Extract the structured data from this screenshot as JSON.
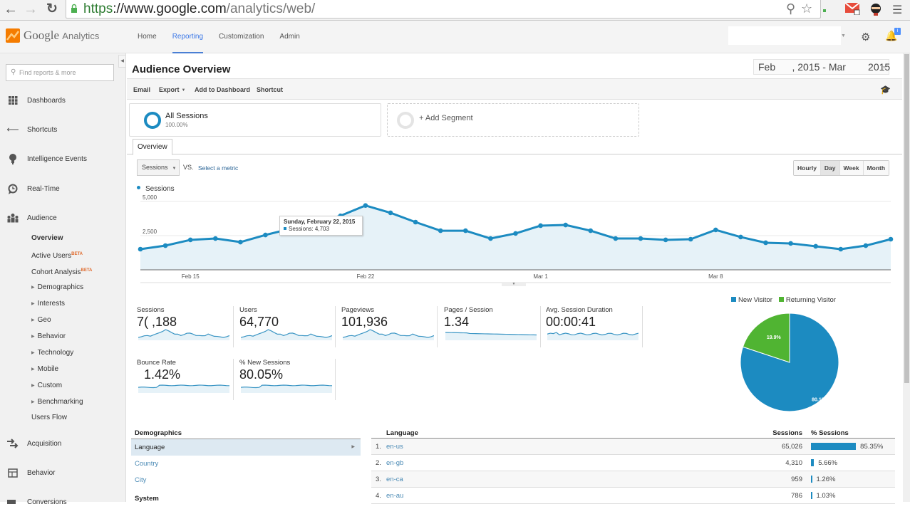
{
  "browser": {
    "url_scheme": "https",
    "url_host": "://www.google.com",
    "url_path": "/analytics/web/"
  },
  "header": {
    "logo_google": "Google",
    "logo_analytics": "Analytics",
    "nav": [
      {
        "label": "Home",
        "active": false
      },
      {
        "label": "Reporting",
        "active": true
      },
      {
        "label": "Customization",
        "active": false
      },
      {
        "label": "Admin",
        "active": false
      }
    ],
    "notification_badge": "i"
  },
  "sidebar": {
    "search_placeholder": "Find reports & more",
    "sections": [
      {
        "label": "Dashboards",
        "icon": "grid-icon"
      },
      {
        "label": "Shortcuts",
        "icon": "shortcut-arrow-icon"
      },
      {
        "label": "Intelligence Events",
        "icon": "lightbulb-icon"
      },
      {
        "label": "Real-Time",
        "icon": "clock-icon"
      },
      {
        "label": "Audience",
        "icon": "people-icon"
      }
    ],
    "audience_items": [
      {
        "label": "Overview",
        "active": true,
        "expandable": false,
        "badge": ""
      },
      {
        "label": "Active Users",
        "active": false,
        "expandable": false,
        "badge": "BETA"
      },
      {
        "label": "Cohort Analysis",
        "active": false,
        "expandable": false,
        "badge": "BETA"
      },
      {
        "label": "Demographics",
        "active": false,
        "expandable": true,
        "badge": ""
      },
      {
        "label": "Interests",
        "active": false,
        "expandable": true,
        "badge": ""
      },
      {
        "label": "Geo",
        "active": false,
        "expandable": true,
        "badge": ""
      },
      {
        "label": "Behavior",
        "active": false,
        "expandable": true,
        "badge": ""
      },
      {
        "label": "Technology",
        "active": false,
        "expandable": true,
        "badge": ""
      },
      {
        "label": "Mobile",
        "active": false,
        "expandable": true,
        "badge": ""
      },
      {
        "label": "Custom",
        "active": false,
        "expandable": true,
        "badge": ""
      },
      {
        "label": "Benchmarking",
        "active": false,
        "expandable": true,
        "badge": ""
      },
      {
        "label": "Users Flow",
        "active": false,
        "expandable": false,
        "badge": ""
      }
    ],
    "bottom_sections": [
      {
        "label": "Acquisition",
        "icon": "acquisition-icon"
      },
      {
        "label": "Behavior",
        "icon": "behavior-icon"
      },
      {
        "label": "Conversions",
        "icon": "conversions-icon"
      }
    ]
  },
  "main": {
    "title": "Audience Overview",
    "date_range": "Feb      , 2015 - Mar        2015",
    "toolbar": {
      "email": "Email",
      "export": "Export",
      "add_to_dashboard": "Add to Dashboard",
      "shortcut": "Shortcut"
    },
    "segments": {
      "all_title": "All Sessions",
      "all_pct": "100.00%",
      "add_label": "+ Add Segment"
    },
    "tab": "Overview",
    "metric_select": "Sessions",
    "vs": "VS.",
    "select_metric": "Select a metric",
    "granularity": [
      {
        "label": "Hourly",
        "active": false
      },
      {
        "label": "Day",
        "active": true
      },
      {
        "label": "Week",
        "active": false
      },
      {
        "label": "Month",
        "active": false
      }
    ],
    "tooltip": {
      "date": "Sunday, February 22, 2015",
      "value": "Sessions: 4,703"
    },
    "scorecards": [
      {
        "name": "Sessions",
        "value": "7( ,188"
      },
      {
        "name": "Users",
        "value": "64,770"
      },
      {
        "name": "Pageviews",
        "value": "101,936"
      },
      {
        "name": "Pages / Session",
        "value": "1.34"
      },
      {
        "name": "Avg. Session Duration",
        "value": "00:00:41"
      },
      {
        "name": "Bounce Rate",
        "value": "  1.42%"
      },
      {
        "name": "% New Sessions",
        "value": "80.05%"
      }
    ],
    "demographics": {
      "title": "Demographics",
      "items": [
        {
          "label": "Language",
          "active": true
        },
        {
          "label": "Country",
          "active": false
        },
        {
          "label": "City",
          "active": false
        }
      ],
      "system_title": "System"
    },
    "language_table": {
      "headers": {
        "language": "Language",
        "sessions": "Sessions",
        "pct": "% Sessions"
      },
      "rows": [
        {
          "rank": "1.",
          "language": "en-us",
          "sessions": "65,026",
          "pct": "85.35%",
          "pct_value": 85.35
        },
        {
          "rank": "2.",
          "language": "en-gb",
          "sessions": "4,310",
          "pct": "5.66%",
          "pct_value": 5.66
        },
        {
          "rank": "3.",
          "language": "en-ca",
          "sessions": "959",
          "pct": "1.26%",
          "pct_value": 1.26
        },
        {
          "rank": "4.",
          "language": "en-au",
          "sessions": "786",
          "pct": "1.03%",
          "pct_value": 1.03
        }
      ]
    }
  },
  "colors": {
    "accent": "#1c8bc1",
    "returning": "#50b432",
    "link": "#4a8ab5"
  },
  "chart_data": [
    {
      "type": "area",
      "title": "",
      "series": [
        {
          "name": "Sessions",
          "values": [
            1510,
            1770,
            2190,
            2290,
            2030,
            2550,
            3000,
            3450,
            3950,
            4703,
            4170,
            3490,
            2860,
            2860,
            2290,
            2660,
            3230,
            3280,
            2860,
            2290,
            2290,
            2190,
            2240,
            2920,
            2400,
            1980,
            1930,
            1720,
            1510,
            1770,
            2240
          ]
        }
      ],
      "x_tick_labels": [
        {
          "label": "Feb 15",
          "index": 2
        },
        {
          "label": "Feb 22",
          "index": 9
        },
        {
          "label": "Mar 1",
          "index": 16
        },
        {
          "label": "Mar 8",
          "index": 23
        }
      ],
      "y_tick_labels": [
        "2,500",
        "5,000"
      ],
      "y_ticks": [
        2500,
        5000
      ],
      "ylim": [
        0,
        5000
      ],
      "legend": "top-left",
      "grid": true
    },
    {
      "type": "pie",
      "title": "",
      "labels": [
        "New Visitor",
        "Returning Visitor"
      ],
      "values": [
        80.1,
        19.9
      ],
      "value_labels": [
        "80.1%",
        "19.9%"
      ],
      "legend": "top"
    }
  ]
}
